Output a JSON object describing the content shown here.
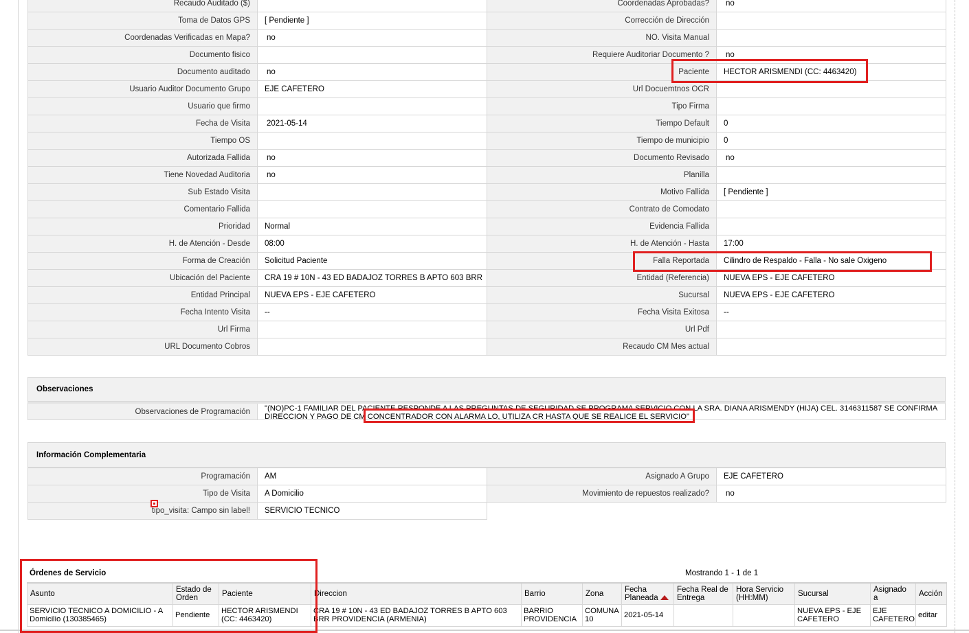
{
  "main_left_rows": [
    {
      "label": "Recaudo Auditado ($)",
      "value": ""
    },
    {
      "label": "Toma de Datos GPS",
      "value": "[ Pendiente ]"
    },
    {
      "label": "Coordenadas Verificadas en Mapa?",
      "value": "no"
    },
    {
      "label": "Documento fisico",
      "value": ""
    },
    {
      "label": "Documento auditado",
      "value": "no"
    },
    {
      "label": "Usuario Auditor Documento Grupo",
      "value": "EJE CAFETERO"
    },
    {
      "label": "Usuario que firmo",
      "value": ""
    },
    {
      "label": "Fecha de Visita",
      "value": "2021-05-14"
    },
    {
      "label": "Tiempo OS",
      "value": ""
    },
    {
      "label": "Autorizada Fallida",
      "value": "no"
    },
    {
      "label": "Tiene Novedad Auditoria",
      "value": "no"
    },
    {
      "label": "Sub Estado Visita",
      "value": ""
    },
    {
      "label": "Comentario Fallida",
      "value": ""
    },
    {
      "label": "Prioridad",
      "value": "Normal"
    },
    {
      "label": "H. de Atención - Desde",
      "value": "08:00"
    },
    {
      "label": "Forma de Creación",
      "value": "Solicitud Paciente"
    },
    {
      "label": "Ubicación del Paciente",
      "value": "CRA 19 # 10N - 43 ED BADAJOZ TORRES B APTO 603 BRR"
    },
    {
      "label": "Entidad Principal",
      "value": "NUEVA EPS - EJE CAFETERO"
    },
    {
      "label": "Fecha Intento Visita",
      "value": "--"
    },
    {
      "label": "Url Firma",
      "value": ""
    },
    {
      "label": "URL Documento Cobros",
      "value": ""
    }
  ],
  "main_right_rows": [
    {
      "label": "Coordenadas Aprobadas?",
      "value": "no"
    },
    {
      "label": "Corrección de Dirección",
      "value": ""
    },
    {
      "label": "NO. Visita Manual",
      "value": ""
    },
    {
      "label": "Requiere Auditoriar Documento ?",
      "value": "no"
    },
    {
      "label": "Paciente",
      "value": "HECTOR ARISMENDI (CC: 4463420)"
    },
    {
      "label": "Url Docuemtnos OCR",
      "value": ""
    },
    {
      "label": "Tipo Firma",
      "value": ""
    },
    {
      "label": "Tiempo Default",
      "value": "0"
    },
    {
      "label": "Tiempo de municipio",
      "value": "0"
    },
    {
      "label": "Documento Revisado",
      "value": "no"
    },
    {
      "label": "Planilla",
      "value": ""
    },
    {
      "label": "Motivo Fallida",
      "value": "[ Pendiente ]"
    },
    {
      "label": "Contrato de Comodato",
      "value": ""
    },
    {
      "label": "Evidencia Fallida",
      "value": ""
    },
    {
      "label": "H. de Atención - Hasta",
      "value": "17:00"
    },
    {
      "label": "Falla Reportada",
      "value": "Cilindro de Respaldo - Falla - No sale Oxigeno"
    },
    {
      "label": "Entidad (Referencia)",
      "value": "NUEVA EPS - EJE CAFETERO"
    },
    {
      "label": "Sucursal",
      "value": "NUEVA EPS - EJE CAFETERO"
    },
    {
      "label": "Fecha Visita Exitosa",
      "value": "--"
    },
    {
      "label": "Url Pdf",
      "value": ""
    },
    {
      "label": "Recaudo CM Mes actual",
      "value": ""
    }
  ],
  "observaciones": {
    "title": "Observaciones",
    "label": "Observaciones de Programación",
    "text": "\"(NO)PC-1 FAMILIAR DEL PACIENTE RESPONDE A LAS PREGUNTAS DE SEGURIDAD SE PROGRAMA SERVICIO CON LA SRA. DIANA ARISMENDY (HIJA) CEL. 3146311587 SE CONFIRMA DIRECCION Y PAGO DE CM CONCENTRADOR CON ALARMA LO, UTILIZA CR HASTA QUE SE REALICE EL SERVICIO\""
  },
  "complementaria": {
    "title": "Información Complementaria",
    "left_rows": [
      {
        "label": "Programación",
        "value": "AM"
      },
      {
        "label": "Tipo de Visita",
        "value": "A Domicilio"
      },
      {
        "label": "tipo_visita: Campo sin label!",
        "value": "SERVICIO TECNICO"
      }
    ],
    "right_rows": [
      {
        "label": "Asignado A Grupo",
        "value": "EJE CAFETERO"
      },
      {
        "label": "Movimiento de repuestos realizado?",
        "value": "no"
      }
    ]
  },
  "ordenes": {
    "title": "Órdenes de Servicio",
    "count_text": "Mostrando 1 - 1 de 1",
    "columns": [
      "Asunto",
      "Estado de Orden",
      "Paciente",
      "Direccion",
      "Barrio",
      "Zona",
      "Fecha Planeada",
      "Fecha Real de Entrega",
      "Hora Servicio (HH:MM)",
      "Sucursal",
      "Asignado a",
      "Acción"
    ],
    "rows": [
      {
        "asunto": "SERVICIO TECNICO A DOMICILIO - A Domicilio (130385465)",
        "estado": "Pendiente",
        "paciente": "HECTOR ARISMENDI (CC: 4463420)",
        "direccion": "CRA 19 # 10N - 43 ED BADAJOZ TORRES B APTO 603 BRR PROVIDENCIA (ARMENIA)",
        "barrio": "BARRIO PROVIDENCIA",
        "zona": "COMUNA 10",
        "fecha_planeada": "2021-05-14",
        "fecha_real": "",
        "hora": "",
        "sucursal": "NUEVA EPS - EJE CAFETERO",
        "asignado": "EJE CAFETERO",
        "accion": "editar"
      }
    ]
  },
  "colors": {
    "highlight": "#e02020",
    "label_bg": "#f1f1f1",
    "border": "#d7d7d7",
    "sort_arrow": "#b71c1c"
  }
}
